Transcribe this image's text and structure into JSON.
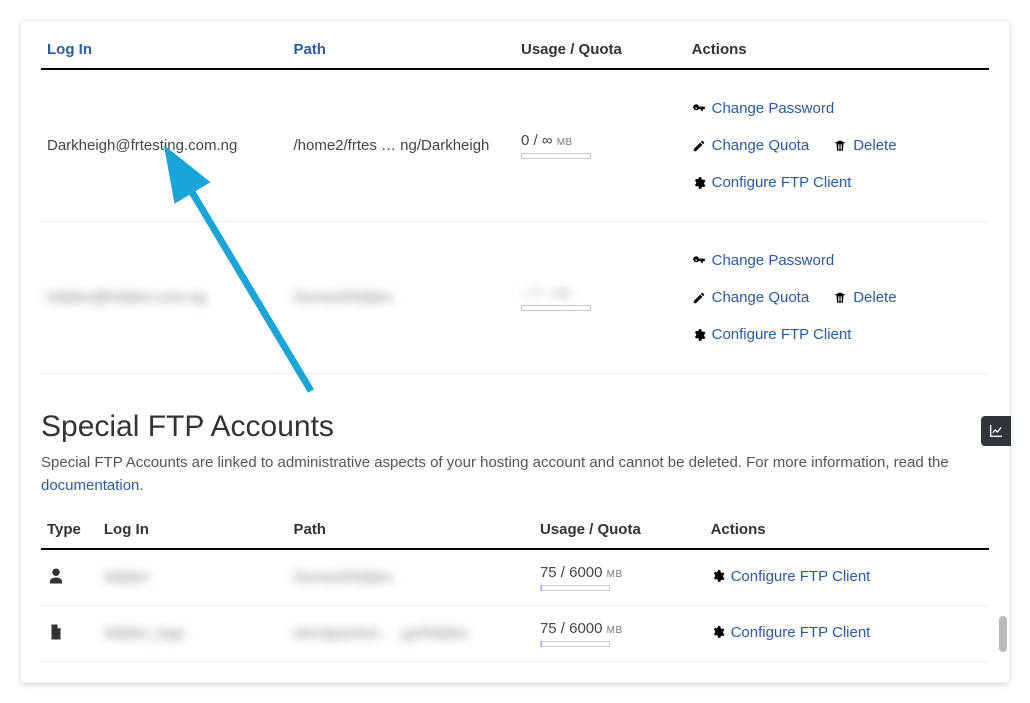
{
  "ftp_table": {
    "headers": {
      "login": "Log In",
      "path": "Path",
      "usage": "Usage",
      "quota": "Quota",
      "actions": "Actions"
    },
    "rows": [
      {
        "login": "Darkheigh@frtesting.com.ng",
        "path": "/home2/frtes … ng/Darkheigh",
        "usage": "0 / ∞",
        "unit": "MB",
        "fill_pct": 0,
        "blurred": false
      },
      {
        "login": "hidden@hidden.com.ng",
        "path": "/home2/hidden",
        "usage": "– / –",
        "unit": "MB",
        "fill_pct": 0,
        "blurred": true
      }
    ],
    "actions": {
      "change_password": "Change Password",
      "change_quota": "Change Quota",
      "delete": "Delete",
      "configure": "Configure FTP Client"
    }
  },
  "special": {
    "title": "Special FTP Accounts",
    "desc_before": "Special FTP Accounts are linked to administrative aspects of your hosting account and cannot be deleted. For more information, read the ",
    "doc_link": "documentation",
    "desc_after": ".",
    "headers": {
      "type": "Type",
      "login": "Log In",
      "path": "Path",
      "usage": "Usage / Quota",
      "actions": "Actions"
    },
    "rows": [
      {
        "icon": "person",
        "login": "hidden",
        "path": "/home2/hidden",
        "usage": "75 / 6000",
        "unit": "MB",
        "fill_pct": 2
      },
      {
        "icon": "file",
        "login": "hidden_logs",
        "path": "/etc/apache2 … gs/hidden",
        "usage": "75 / 6000",
        "unit": "MB",
        "fill_pct": 2
      }
    ],
    "configure": "Configure FTP Client"
  }
}
